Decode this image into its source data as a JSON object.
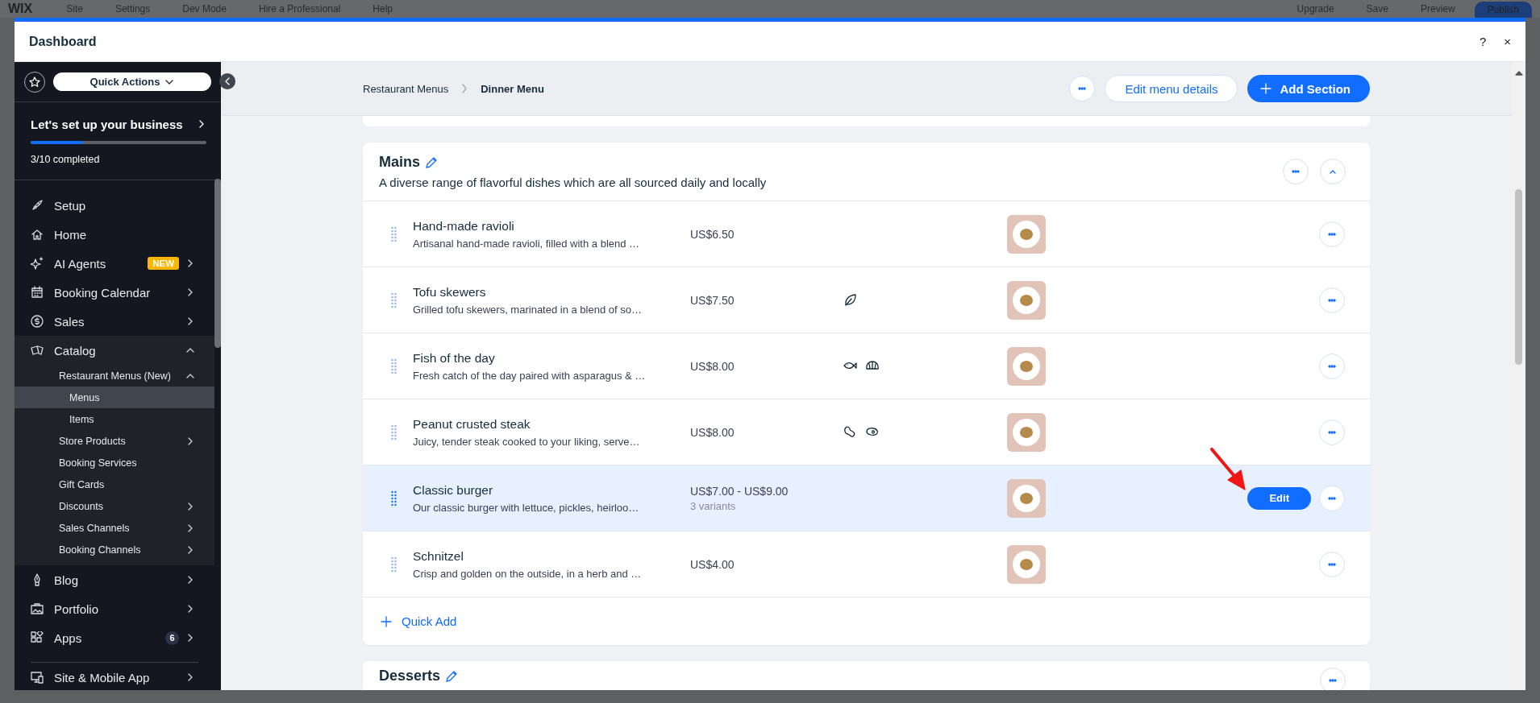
{
  "editor_bar": {
    "logo": "WIX",
    "menu": [
      "Site",
      "Settings",
      "Dev Mode",
      "Hire a Professional",
      "Help"
    ],
    "actions": [
      "Upgrade",
      "Save",
      "Preview"
    ],
    "publish": "Publish"
  },
  "window": {
    "title": "Dashboard",
    "help": "?",
    "close": "×"
  },
  "sidebar": {
    "quick_actions": "Quick Actions",
    "setup": {
      "title": "Let's set up your business",
      "level": 0.3,
      "progress_text": "3/10 completed"
    },
    "items": [
      {
        "label": "Setup",
        "selected": false
      },
      {
        "label": "Home",
        "selected": false
      },
      {
        "label": "AI Agents",
        "badge": "NEW",
        "expanded": false,
        "selected": false
      },
      {
        "label": "Booking Calendar",
        "expanded": false,
        "selected": false
      },
      {
        "label": "Sales",
        "expanded": false,
        "selected": false
      },
      {
        "label": "Catalog",
        "expanded": true,
        "selected": false,
        "children": [
          {
            "label": "Restaurant Menus (New)",
            "expanded": true,
            "selected": false,
            "children": [
              {
                "label": "Menus",
                "selected": true
              },
              {
                "label": "Items",
                "selected": false
              }
            ]
          },
          {
            "label": "Store Products",
            "expanded": false,
            "selected": false
          },
          {
            "label": "Booking Services",
            "selected": false
          },
          {
            "label": "Gift Cards",
            "selected": false
          },
          {
            "label": "Discounts",
            "expanded": false,
            "selected": false
          },
          {
            "label": "Sales Channels",
            "expanded": false,
            "selected": false
          },
          {
            "label": "Booking Channels",
            "expanded": false,
            "selected": false
          }
        ]
      },
      {
        "label": "Blog",
        "expanded": false,
        "selected": false
      },
      {
        "label": "Portfolio",
        "expanded": false,
        "selected": false
      },
      {
        "label": "Apps",
        "count": "6",
        "expanded": false,
        "selected": false
      },
      {
        "label": "Site & Mobile App",
        "expanded": false,
        "selected": false,
        "divider_before": true
      }
    ]
  },
  "header": {
    "breadcrumb": [
      "Restaurant Menus",
      "Dinner Menu"
    ],
    "edit_button": "Edit menu details",
    "add_button": "Add Section"
  },
  "sections": [
    {
      "title": "Mains",
      "description": "A diverse range of flavorful dishes which are all sourced daily and locally",
      "expanded": true,
      "items": [
        {
          "name": "Hand-made ravioli",
          "description": "Artisanal hand-made ravioli, filled with a blend …",
          "price": "US$6.50",
          "selected": false
        },
        {
          "name": "Tofu skewers",
          "description": "Grilled tofu skewers, marinated in a blend of so…",
          "price": "US$7.50",
          "tags": [
            {
              "kind": "vegan"
            }
          ],
          "selected": false
        },
        {
          "name": "Fish of the day",
          "description": "Fresh catch of the day paired with asparagus & …",
          "price": "US$8.00",
          "tags": [
            {
              "kind": "fish"
            },
            {
              "kind": "shellfish"
            }
          ],
          "selected": false
        },
        {
          "name": "Peanut crusted steak",
          "description": "Juicy, tender steak cooked to your liking, serve…",
          "price": "US$8.00",
          "tags": [
            {
              "kind": "nuts"
            },
            {
              "kind": "meat"
            }
          ],
          "selected": false
        },
        {
          "name": "Classic burger",
          "description": "Our classic burger with lettuce, pickles, heirloo…",
          "price": "US$7.00 - US$9.00",
          "variants": "3 variants",
          "selected": true,
          "action": "Edit"
        },
        {
          "name": "Schnitzel",
          "description": "Crisp and golden on the outside, in a herb and …",
          "price": "US$4.00",
          "selected": false
        }
      ],
      "quick_add": "Quick Add"
    },
    {
      "title": "Desserts"
    }
  ]
}
